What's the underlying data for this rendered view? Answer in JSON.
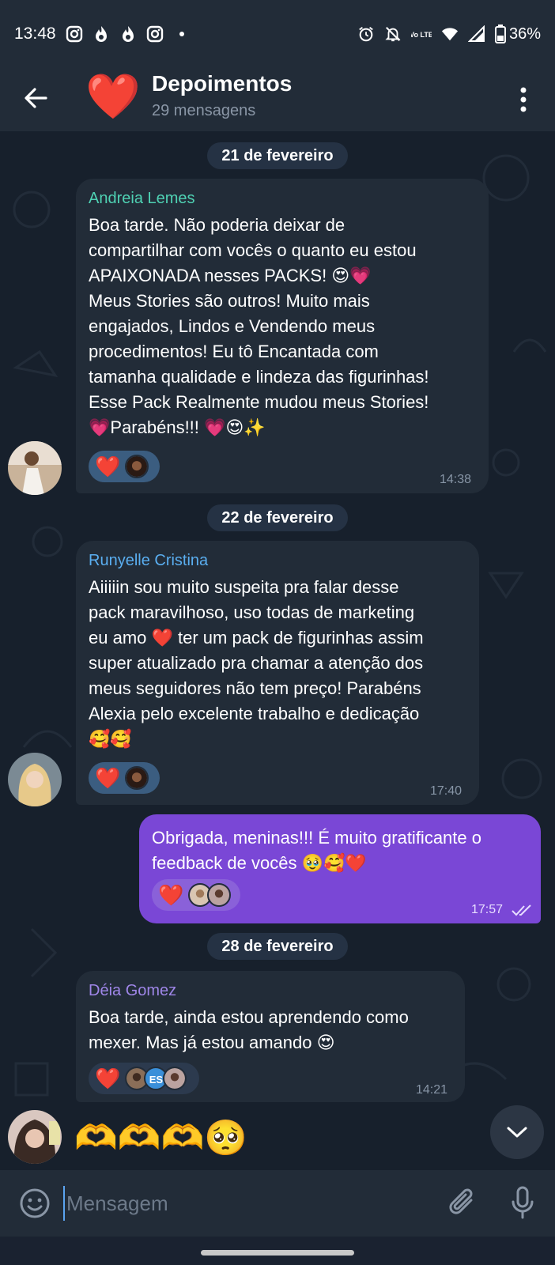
{
  "status_bar": {
    "time": "13:48",
    "battery": "36%",
    "lte_label": "Vo LTE",
    "left_icons": [
      "instagram-icon",
      "flame-icon",
      "flame-icon",
      "instagram-icon",
      "dot-icon"
    ],
    "right_icons": [
      "alarm-icon",
      "bell-off-icon",
      "lte-icon",
      "wifi-icon",
      "signal-icon",
      "battery-icon"
    ]
  },
  "header": {
    "title": "Depoimentos",
    "subtitle": "29 mensagens",
    "avatar_emoji": "❤️"
  },
  "dates": {
    "d1": "21 de fevereiro",
    "d2": "22 de fevereiro",
    "d3": "28 de fevereiro"
  },
  "messages": [
    {
      "sender": "Andreia Lemes",
      "sender_color": "#4fd1b3",
      "text": "Boa tarde. Não poderia deixar de\ncompartilhar com vocês o quanto eu estou\nAPAIXONADA nesses PACKS! 😍💗\nMeus Stories são outros! Muito mais\nengajados, Lindos e Vendendo meus\nprocedimentos! Eu tô Encantada com\ntamanha qualidade e lindeza das figurinhas!\nEsse Pack Realmente mudou meus Stories!\n💗Parabéns!!! 💗😍✨",
      "reaction": "❤️",
      "time": "14:38"
    },
    {
      "sender": "Runyelle Cristina",
      "sender_color": "#5aaef0",
      "text": "Aiiiiin sou muito suspeita pra falar desse\npack maravilhoso, uso todas de marketing\neu amo ❤️ ter um pack de figurinhas assim\nsuper atualizado pra chamar a atenção dos\nmeus seguidores não tem preço! Parabéns\nAlexia pelo excelente trabalho e dedicação\n🥰🥰",
      "reaction": "❤️",
      "time": "17:40"
    },
    {
      "text": "Obrigada, meninas!!! É muito gratificante o\nfeedback de vocês 🥹🥰❤️",
      "reaction": "❤️",
      "time": "17:57"
    },
    {
      "sender": "Déia Gomez",
      "sender_color": "#9f86e8",
      "text": "Boa tarde, ainda estou aprendendo como\nmexer. Mas já estou amando 😍",
      "reaction": "❤️",
      "reactor_initials": "ES",
      "time": "14:21"
    }
  ],
  "last_message_emojis": "🫶🫶🫶🥺",
  "input": {
    "placeholder": "Mensagem"
  },
  "colors": {
    "background": "#17202c",
    "bar": "#222c38",
    "outgoing_bubble": "#7a47d6",
    "incoming_bubble": "#222c38"
  }
}
